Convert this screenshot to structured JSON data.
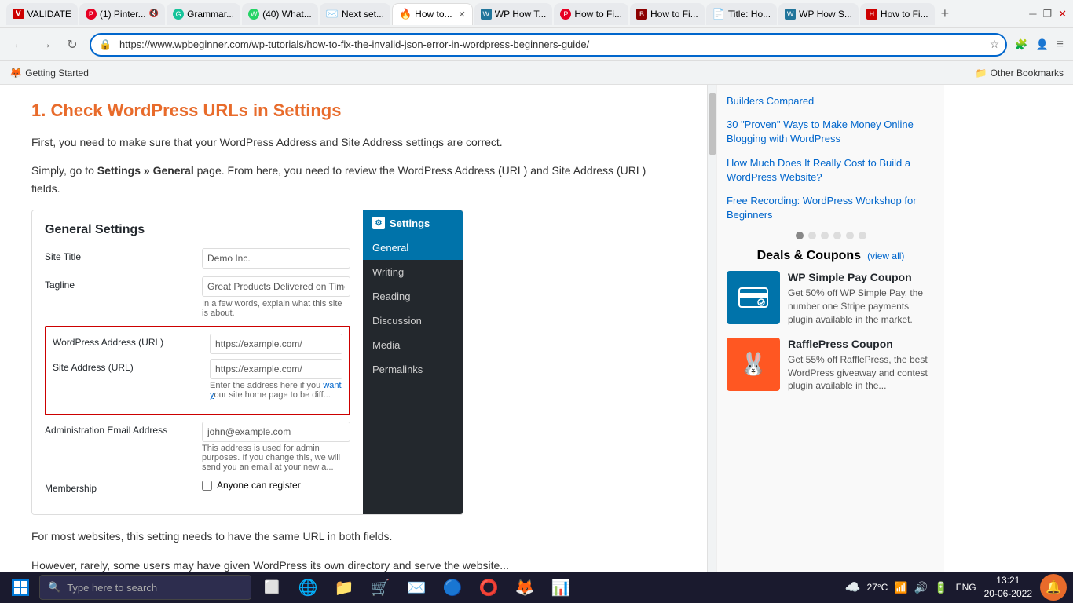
{
  "browser": {
    "tabs": [
      {
        "id": "validate",
        "label": "VALIDATE",
        "favicon_color": "#cc0000",
        "favicon_text": "V",
        "active": false
      },
      {
        "id": "pinterest",
        "label": "(1) Pinter...",
        "favicon_color": "#e60023",
        "favicon_text": "P",
        "active": false,
        "muted": true
      },
      {
        "id": "grammarly",
        "label": "Grammar...",
        "favicon_color": "#15c39a",
        "favicon_text": "G",
        "active": false
      },
      {
        "id": "whatsapp",
        "label": "(40) What...",
        "favicon_color": "#25d366",
        "favicon_text": "W",
        "active": false
      },
      {
        "id": "gmail",
        "label": "Next set...",
        "favicon_color": "#ea4335",
        "favicon_text": "M",
        "active": false
      },
      {
        "id": "howto_active",
        "label": "How to...",
        "favicon_color": "#ff6600",
        "favicon_text": "🔥",
        "active": true
      },
      {
        "id": "wp1",
        "label": "WP How T...",
        "favicon_color": "#21759b",
        "favicon_text": "W",
        "active": false
      },
      {
        "id": "howto2",
        "label": "How to Fi...",
        "favicon_color": "#e60023",
        "favicon_text": "P",
        "active": false
      },
      {
        "id": "howto3",
        "label": "How to Fi...",
        "favicon_color": "#8B0000",
        "favicon_text": "B",
        "active": false
      },
      {
        "id": "titlehow",
        "label": "Title: Ho...",
        "favicon_color": "#0066cc",
        "favicon_text": "E",
        "active": false
      },
      {
        "id": "wp2",
        "label": "WP How S...",
        "favicon_color": "#21759b",
        "favicon_text": "W",
        "active": false
      },
      {
        "id": "howto4",
        "label": "How to Fi...",
        "favicon_color": "#cc0000",
        "favicon_text": "H",
        "active": false
      }
    ],
    "address": "https://www.wpbeginner.com/wp-tutorials/how-to-fix-the-invalid-json-error-in-wordpress-beginners-guide/",
    "bookmark": "Getting Started",
    "other_bookmarks": "Other Bookmarks"
  },
  "article": {
    "heading": "1. Check WordPress URLs in Settings",
    "para1": "First, you need to make sure that your WordPress Address and Site Address settings are correct.",
    "para2_parts": [
      "Simply, go to ",
      "Settings » General",
      " page. From here, you need to review the WordPress Address (URL) and Site Address (URL) fields."
    ],
    "screenshot": {
      "title": "General Settings",
      "fields": [
        {
          "label": "Site Title",
          "value": "Demo Inc.",
          "type": "text"
        },
        {
          "label": "Tagline",
          "value": "Great Products Delivered on Time",
          "hint": "In a few words, explain what this site is about.",
          "type": "text"
        },
        {
          "label": "WordPress Address (URL)",
          "value": "https://example.com/",
          "type": "url",
          "highlighted": true
        },
        {
          "label": "Site Address (URL)",
          "value": "https://example.com/",
          "hint": "Enter the address here if you want your site home page to be diff...",
          "type": "url",
          "highlighted": true
        },
        {
          "label": "Administration Email Address",
          "value": "john@example.com",
          "hint": "This address is used for admin purposes. If you change this, we will send you an email at your new a...",
          "type": "email"
        },
        {
          "label": "Membership",
          "value": "",
          "checkbox_label": "Anyone can register",
          "type": "checkbox"
        }
      ],
      "wp_menu": {
        "header": "Settings",
        "items": [
          "General",
          "Writing",
          "Reading",
          "Discussion",
          "Media",
          "Permalinks"
        ]
      }
    },
    "para3": "For most websites, this setting needs to have the same URL in both fields.",
    "para4": "However, rarely, some users may have given WordPress its own directory and serve the website..."
  },
  "sidebar": {
    "links": [
      "Builders Compared",
      "30 \"Proven\" Ways to Make Money Online Blogging with WordPress",
      "How Much Does It Really Cost to Build a WordPress Website?",
      "Free Recording: WordPress Workshop for Beginners"
    ],
    "carousel_dots": 6,
    "deals": {
      "title": "Deals & Coupons",
      "view_all": "(view all)",
      "items": [
        {
          "icon": "💳",
          "icon_bg": "blue",
          "title": "WP Simple Pay Coupon",
          "desc": "Get 50% off WP Simple Pay, the number one Stripe payments plugin available in the market."
        },
        {
          "icon": "🐰",
          "icon_bg": "orange",
          "title": "RafflePress Coupon",
          "desc": "Get 55% off RafflePress, the best WordPress giveaway and contest plugin available in the..."
        }
      ]
    }
  },
  "taskbar": {
    "search_placeholder": "Type here to search",
    "apps": [
      "⊞",
      "🔍",
      "⬜",
      "🌐",
      "📁",
      "🛒",
      "⚙️",
      "🦊",
      "🔴"
    ],
    "sys": {
      "weather": "27°C",
      "language": "ENG",
      "time": "13:21",
      "date": "20-06-2022"
    }
  }
}
